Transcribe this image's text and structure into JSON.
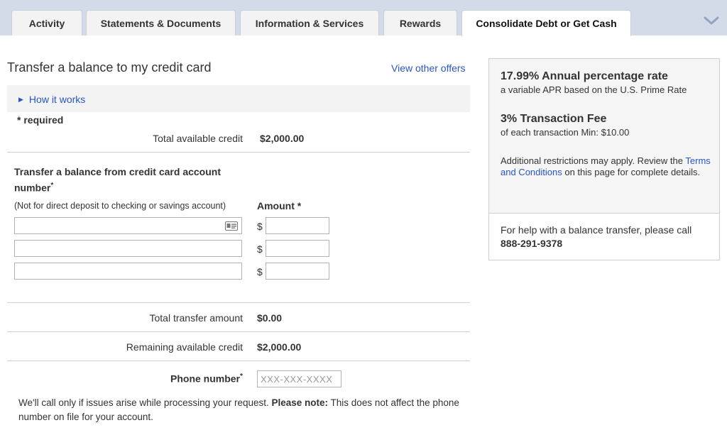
{
  "tabs": [
    {
      "label": "Activity"
    },
    {
      "label": "Statements & Documents"
    },
    {
      "label": "Information & Services"
    },
    {
      "label": "Rewards"
    },
    {
      "label": "Consolidate Debt or Get Cash",
      "active": true
    }
  ],
  "main": {
    "title": "Transfer a balance to my credit card",
    "view_offers": "View other offers",
    "how_it_works": "How it works",
    "required_note": "* required",
    "total_available_label": "Total available credit",
    "total_available_value": "$2,000.00",
    "section_label": "Transfer a balance from credit card account number",
    "section_required_mark": "*",
    "deposit_note": "(Not for direct deposit to checking or savings account)",
    "amount_header": "Amount *",
    "currency_symbol": "$",
    "total_transfer_label": "Total transfer amount",
    "total_transfer_value": "$0.00",
    "remaining_label": "Remaining available credit",
    "remaining_value": "$2,000.00",
    "phone_label": "Phone number",
    "phone_required_mark": "*",
    "phone_placeholder": "XXX-XXX-XXXX",
    "phone_note_start": "We'll call only if issues arise while processing your request.",
    "phone_note_bold": "Please note:",
    "phone_note_end": "This does not affect the phone number on file for your account."
  },
  "panel": {
    "apr_heading": "17.99% Annual percentage rate",
    "apr_sub": "a variable APR based on the U.S. Prime Rate",
    "fee_heading": "3% Transaction Fee",
    "fee_sub": "of each transaction Min: $10.00",
    "restrict_start": "Additional restrictions may apply. Review the",
    "terms_link": "Terms and Conditions",
    "restrict_end": "on this page for complete details.",
    "help_text": "For help with a balance transfer, please call",
    "help_phone": "888-291-9378"
  },
  "colors": {
    "link": "#2855c5",
    "tabbar_bg": "#d3dbe8",
    "panel_bg": "#f5f5f5"
  }
}
